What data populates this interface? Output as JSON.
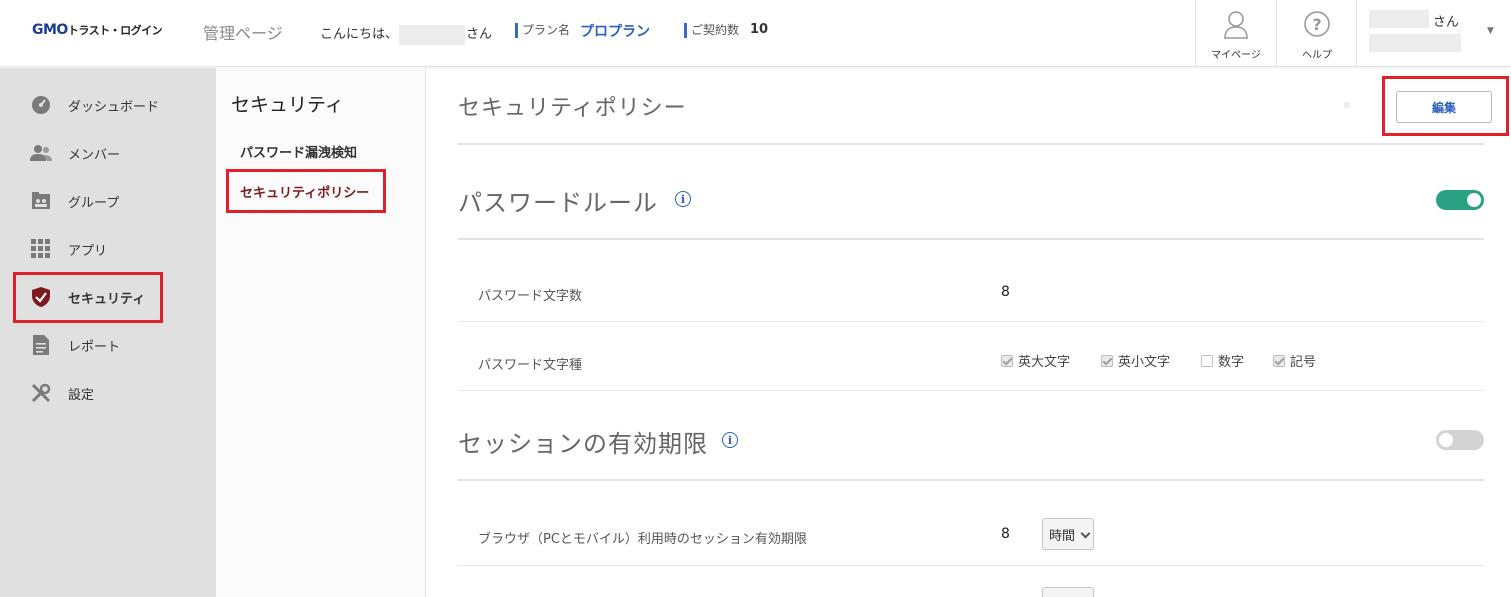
{
  "header": {
    "logo_main": "GMO",
    "logo_sub": "トラスト・ログイン",
    "admin_title": "管理ページ",
    "greeting_prefix": "こんにちは、",
    "greeting_suffix": "さん",
    "plan_label": "プラン名",
    "plan_value": "プロプラン",
    "contract_label": "ご契約数",
    "contract_value": "10",
    "mypage_label": "マイページ",
    "help_label": "ヘルプ",
    "user_suffix": "さん"
  },
  "sidebar": {
    "items": [
      {
        "label": "ダッシュボード",
        "icon": "dashboard-icon"
      },
      {
        "label": "メンバー",
        "icon": "members-icon"
      },
      {
        "label": "グループ",
        "icon": "group-icon"
      },
      {
        "label": "アプリ",
        "icon": "apps-grid-icon"
      },
      {
        "label": "セキュリティ",
        "icon": "shield-check-icon",
        "active": true
      },
      {
        "label": "レポート",
        "icon": "report-icon"
      },
      {
        "label": "設定",
        "icon": "tools-icon"
      }
    ]
  },
  "subnav": {
    "title": "セキュリティ",
    "items": [
      {
        "label": "パスワード漏洩検知"
      },
      {
        "label": "セキュリティポリシー",
        "active": true
      }
    ]
  },
  "main": {
    "title": "セキュリティポリシー",
    "edit_label": "編集",
    "password_rule": {
      "title": "パスワードルール",
      "enabled": true,
      "length_label": "パスワード文字数",
      "length_value": "8",
      "types_label": "パスワード文字種",
      "types": [
        {
          "label": "英大文字",
          "checked": true
        },
        {
          "label": "英小文字",
          "checked": true
        },
        {
          "label": "数字",
          "checked": false
        },
        {
          "label": "記号",
          "checked": true
        }
      ]
    },
    "session": {
      "title": "セッションの有効期限",
      "enabled": false,
      "browser_label": "ブラウザ（PCとモバイル）利用時のセッション有効期限",
      "browser_value": "8",
      "browser_unit": "時間"
    }
  },
  "colors": {
    "accent_blue": "#2c5fbf",
    "toggle_on": "#2ba184",
    "highlight_red": "#e0202a",
    "active_red": "#7a1a1f"
  }
}
